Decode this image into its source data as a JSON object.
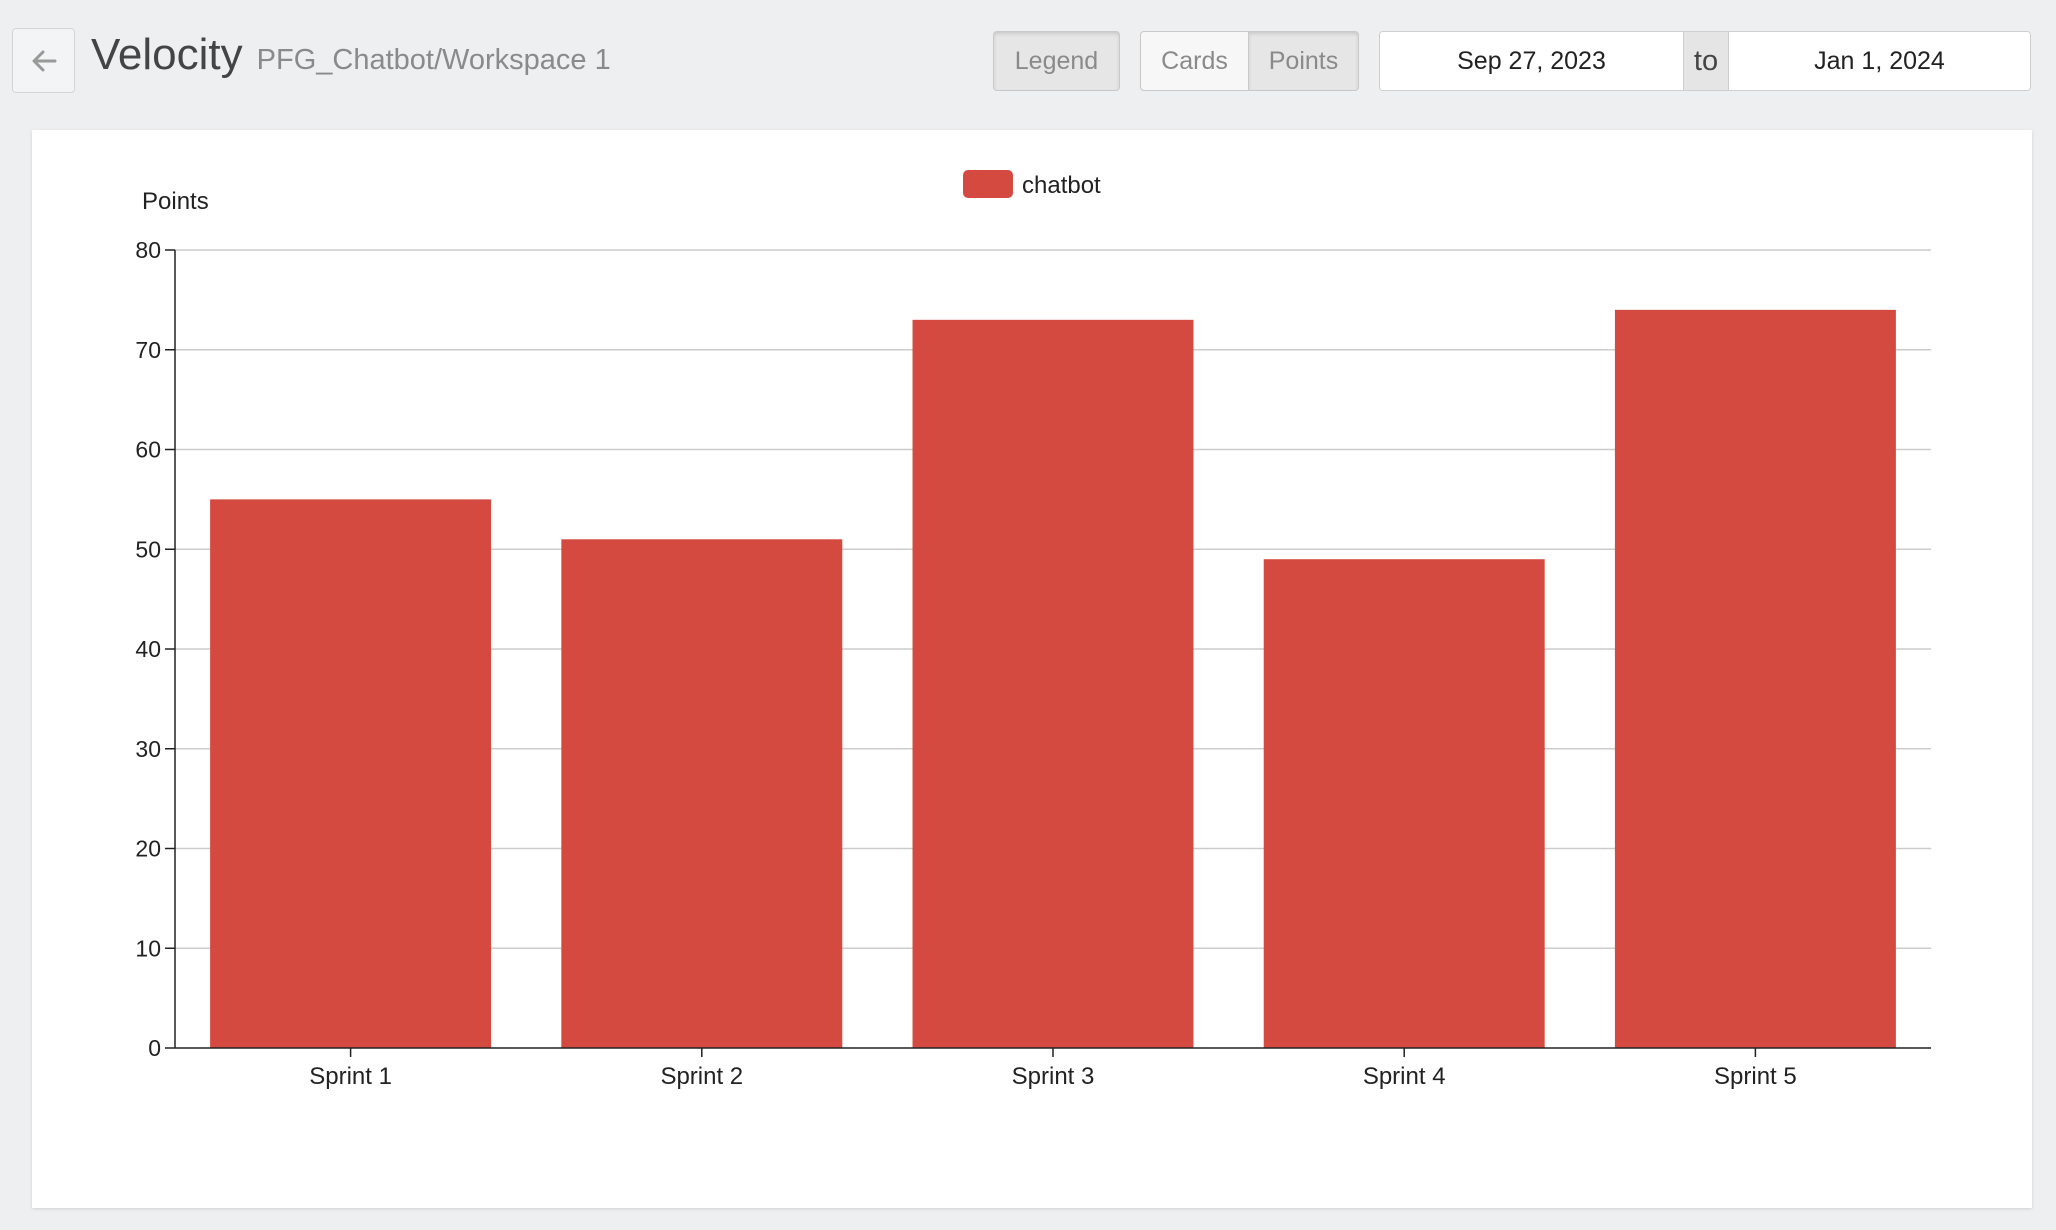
{
  "header": {
    "title": "Velocity",
    "subtitle": "PFG_Chatbot/Workspace 1",
    "back_icon": "arrow-left-icon"
  },
  "toolbar": {
    "legend_label": "Legend",
    "legend_active": true,
    "cards_label": "Cards",
    "points_label": "Points",
    "points_active": true
  },
  "date_range": {
    "from": "Sep 27, 2023",
    "separator": "to",
    "to": "Jan 1, 2024"
  },
  "colors": {
    "bar": "#d44a40",
    "page_background": "#eeeff0"
  },
  "chart_data": {
    "type": "bar",
    "title": "",
    "ylabel": "Points",
    "xlabel": "",
    "categories": [
      "Sprint 1",
      "Sprint 2",
      "Sprint 3",
      "Sprint 4",
      "Sprint 5"
    ],
    "series": [
      {
        "name": "chatbot",
        "values": [
          55,
          51,
          73,
          49,
          74
        ],
        "color": "#d44a40"
      }
    ],
    "ylim": [
      0,
      80
    ],
    "yticks": [
      0,
      10,
      20,
      30,
      40,
      50,
      60,
      70,
      80
    ],
    "grid": true,
    "legend_position": "top-center"
  }
}
